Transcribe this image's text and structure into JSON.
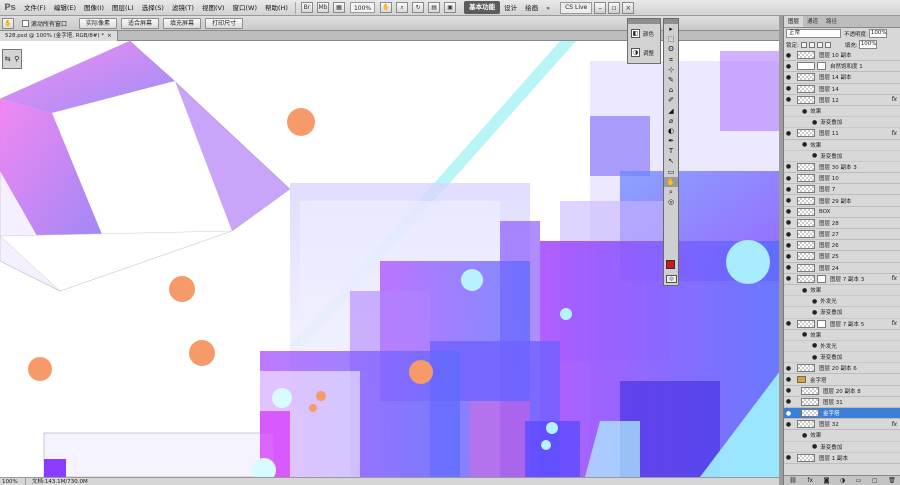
{
  "app": {
    "logo": "Ps"
  },
  "menu": [
    "文件(F)",
    "编辑(E)",
    "图像(I)",
    "图层(L)",
    "选择(S)",
    "滤镜(T)",
    "视图(V)",
    "窗口(W)",
    "帮助(H)"
  ],
  "menubar_tools": {
    "zoom": "100%",
    "workspace_active": "基本功能",
    "workspaces": [
      "设计",
      "绘画"
    ],
    "cs_live": "CS Live"
  },
  "options_bar": {
    "scroll_all_label": "滚动所有窗口",
    "buttons": [
      "实际像素",
      "适合屏幕",
      "填充屏幕",
      "打印尺寸"
    ]
  },
  "document": {
    "tab_title": "528.psd @ 100% (金字塔, RGB/8#) *",
    "close": "×"
  },
  "status": {
    "zoom": "100%",
    "doc": "文档:143.1M/730.0M"
  },
  "mini_panels": [
    {
      "label": "颜色",
      "icon": "color-icon"
    },
    {
      "label": "调整",
      "icon": "adjust-icon"
    }
  ],
  "tools": [
    "▸",
    "⬚",
    "ʘ",
    "⌗",
    "⊹",
    "✎",
    "⌂",
    "✐",
    "◢",
    "⌀",
    "◐",
    "✒",
    "T",
    "↖",
    "▭",
    "✋",
    "⌕",
    "◎"
  ],
  "layers_panel": {
    "tabs": [
      "图层",
      "通道",
      "路径"
    ],
    "blend_mode": "正常",
    "opacity_label": "不透明度:",
    "opacity": "100%",
    "lock_label": "锁定:",
    "fill_label": "填充:",
    "fill": "100%",
    "rows": [
      {
        "kind": "layer",
        "name": "图层 10 副本",
        "fx": ""
      },
      {
        "kind": "adjust",
        "name": "自然饱和度 1",
        "fx": ""
      },
      {
        "kind": "layer",
        "name": "图层 14 副本",
        "fx": ""
      },
      {
        "kind": "layer",
        "name": "图层 14",
        "fx": ""
      },
      {
        "kind": "layer",
        "name": "图层 12",
        "fx": "fx"
      },
      {
        "kind": "effects",
        "name": "效果"
      },
      {
        "kind": "effect",
        "name": "渐变叠加"
      },
      {
        "kind": "layer",
        "name": "图层 11",
        "fx": "fx"
      },
      {
        "kind": "effects",
        "name": "效果"
      },
      {
        "kind": "effect",
        "name": "渐变叠加"
      },
      {
        "kind": "layer",
        "name": "图层 30 副本 3",
        "fx": ""
      },
      {
        "kind": "layer",
        "name": "图层 10",
        "fx": ""
      },
      {
        "kind": "layer",
        "name": "图层 7",
        "fx": ""
      },
      {
        "kind": "layer",
        "name": "图层 29 副本",
        "fx": ""
      },
      {
        "kind": "layer",
        "name": "BOX",
        "fx": ""
      },
      {
        "kind": "layer",
        "name": "图层 28",
        "fx": ""
      },
      {
        "kind": "layer",
        "name": "图层 27",
        "fx": ""
      },
      {
        "kind": "layer",
        "name": "图层 26",
        "fx": ""
      },
      {
        "kind": "layer",
        "name": "图层 25",
        "fx": ""
      },
      {
        "kind": "layer",
        "name": "图层 24",
        "fx": ""
      },
      {
        "kind": "masked",
        "name": "图层 7 副本 3",
        "fx": "fx"
      },
      {
        "kind": "effects",
        "name": "效果"
      },
      {
        "kind": "effect",
        "name": "外发光"
      },
      {
        "kind": "effect",
        "name": "渐变叠加"
      },
      {
        "kind": "masked",
        "name": "图层 7 副本 5",
        "fx": "fx"
      },
      {
        "kind": "effects",
        "name": "效果"
      },
      {
        "kind": "effect",
        "name": "外发光"
      },
      {
        "kind": "effect",
        "name": "渐变叠加"
      },
      {
        "kind": "layer",
        "name": "图层 20 副本 6",
        "fx": ""
      },
      {
        "kind": "group",
        "name": "金字塔",
        "fx": ""
      },
      {
        "kind": "child",
        "name": "图层 20 副本 8",
        "fx": ""
      },
      {
        "kind": "child",
        "name": "图层 31",
        "fx": ""
      },
      {
        "kind": "child-selected",
        "name": "金字塔",
        "fx": ""
      },
      {
        "kind": "layer",
        "name": "图层 32",
        "fx": "fx"
      },
      {
        "kind": "effects",
        "name": "效果"
      },
      {
        "kind": "effect",
        "name": "渐变叠加"
      },
      {
        "kind": "layer",
        "name": "图层 1 副本",
        "fx": ""
      }
    ],
    "footer_icons": [
      "link-icon",
      "fx-icon",
      "mask-icon",
      "adjustment-icon",
      "folder-icon",
      "new-layer-icon",
      "trash-icon"
    ]
  },
  "colors": {
    "foreground": "#cc1a14",
    "background": "#ffffff",
    "selection": "#3d7fd6"
  }
}
